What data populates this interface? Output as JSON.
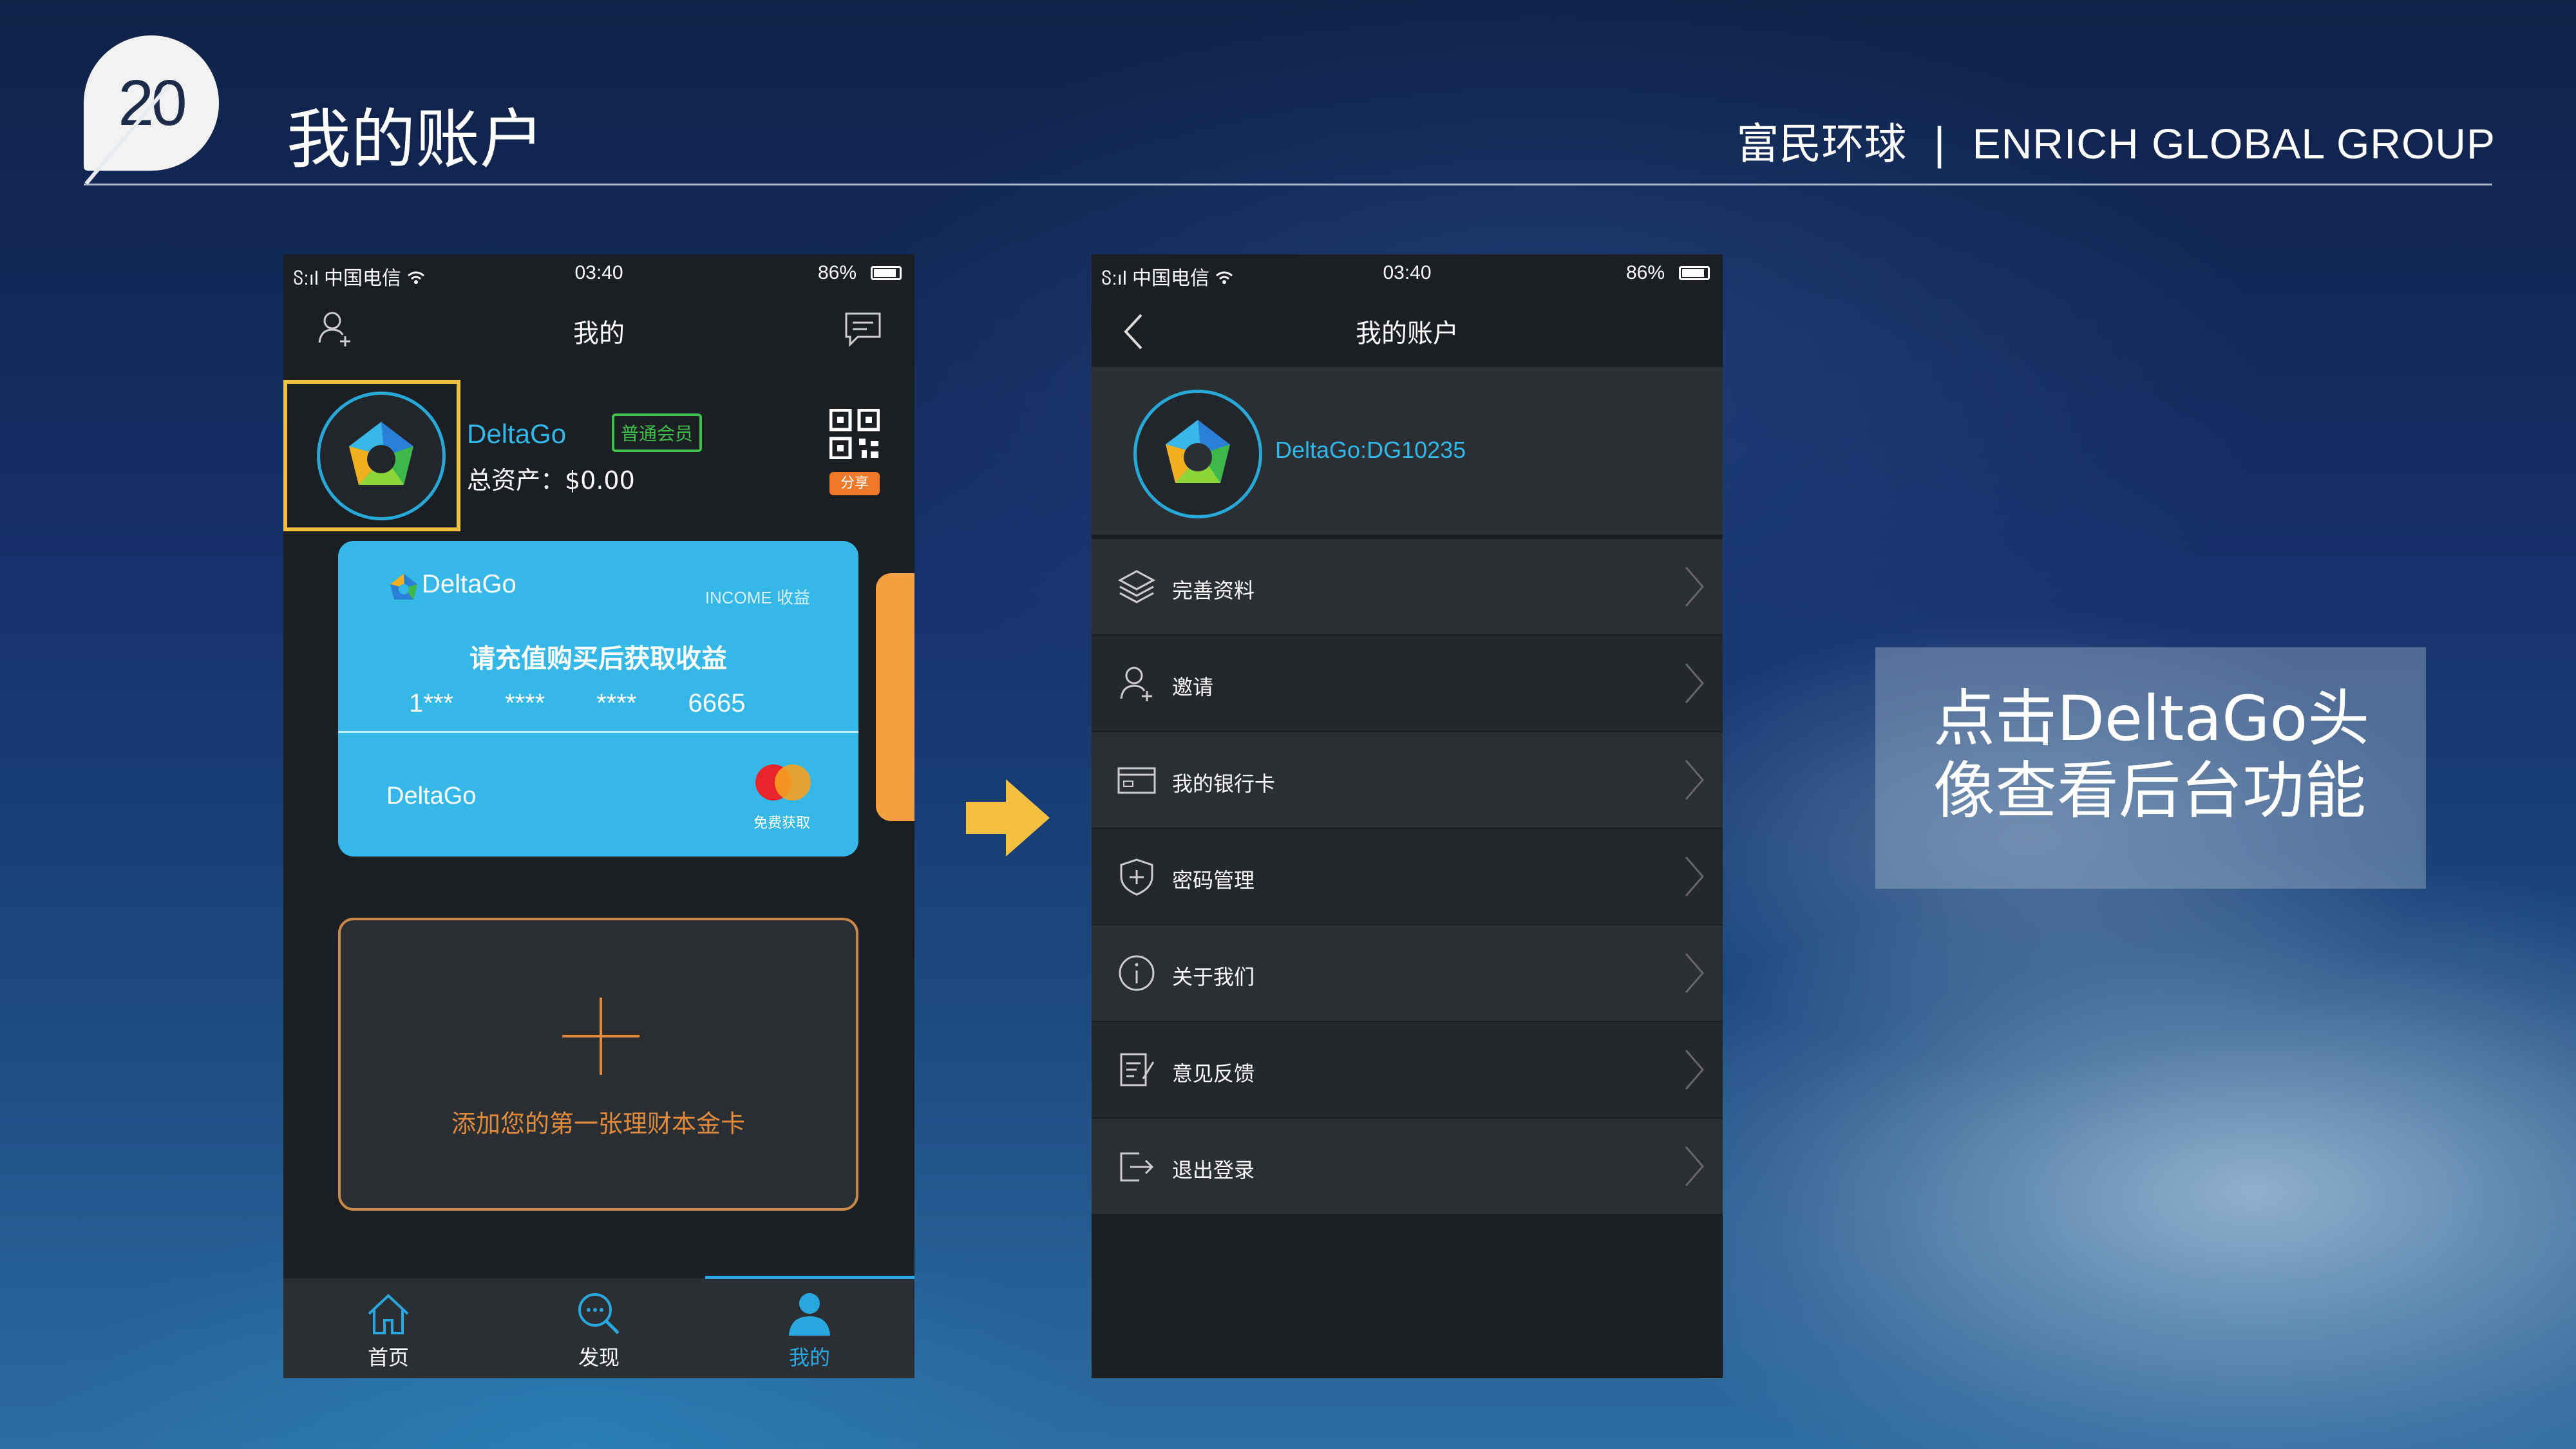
{
  "slide": {
    "number": "20",
    "title": "我的账户",
    "brand_cn": "富民环球",
    "brand_sep": "|",
    "brand_en": "ENRICH GLOBAL GROUP"
  },
  "left_phone": {
    "status": {
      "carrier": "ჽ:ıl 中国电信 ",
      "time": "03:40",
      "battery": "86%"
    },
    "nav_title": "我的",
    "profile": {
      "name": "DeltaGo",
      "member_badge": "普通会员",
      "assets": "总资产：$0.00",
      "share": "分享"
    },
    "card": {
      "brand": "DeltaGo",
      "income": "INCOME 收益",
      "prompt": "请充值购买后获取收益",
      "number_groups": [
        "1***",
        "****",
        "****",
        "6665"
      ],
      "holder": "DeltaGo",
      "free_get": "免费获取"
    },
    "add_card": {
      "label": "添加您的第一张理财本金卡"
    },
    "tabs": [
      {
        "label": "首页",
        "icon": "home-icon"
      },
      {
        "label": "发现",
        "icon": "search-icon"
      },
      {
        "label": "我的",
        "icon": "user-icon",
        "active": true
      }
    ],
    "colors": {
      "accent": "#29a8e0",
      "highlight_box": "#f0c040",
      "orange": "#e08a3a",
      "member_green": "#3ec04a"
    }
  },
  "right_phone": {
    "status": {
      "carrier": "ჽ:ıl 中国电信 ",
      "time": "03:40",
      "battery": "86%"
    },
    "nav_title": "我的账户",
    "profile": {
      "id": "DeltaGo:DG10235"
    },
    "menu": [
      {
        "label": "完善资料",
        "icon": "layers-icon"
      },
      {
        "label": "邀请",
        "icon": "add-user-icon"
      },
      {
        "label": "我的银行卡",
        "icon": "bank-card-icon"
      },
      {
        "label": "密码管理",
        "icon": "shield-icon"
      },
      {
        "label": "关于我们",
        "icon": "info-icon"
      },
      {
        "label": "意见反馈",
        "icon": "feedback-icon"
      },
      {
        "label": "退出登录",
        "icon": "logout-icon"
      }
    ]
  },
  "callout": {
    "line1": "点击DeltaGo头",
    "line2": "像查看后台功能"
  }
}
